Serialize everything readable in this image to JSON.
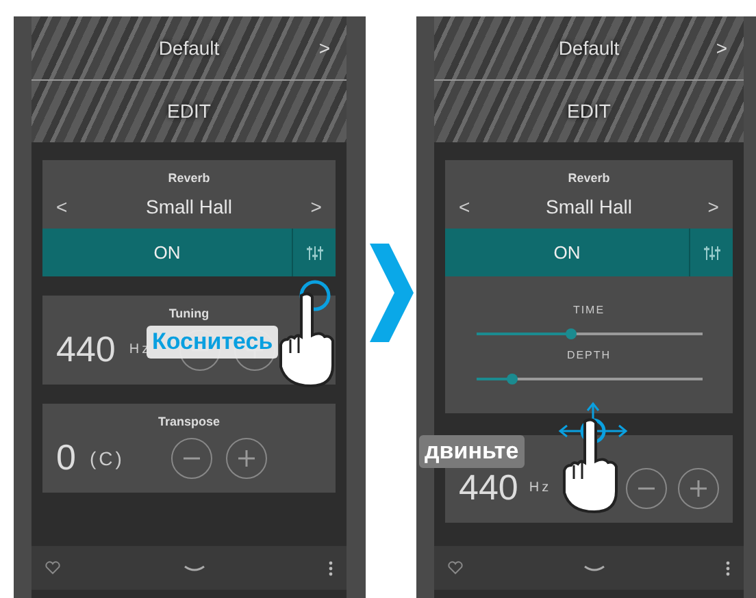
{
  "screens": [
    {
      "header": {
        "preset": "Default",
        "next": ">",
        "edit": "EDIT"
      },
      "reverb": {
        "title": "Reverb",
        "prev": "<",
        "value": "Small Hall",
        "next": ">",
        "status": "ON",
        "on": true
      },
      "cards": [
        {
          "title": "Tuning",
          "value": "440",
          "unit": "Hz"
        },
        {
          "title": "Transpose",
          "value": "0",
          "unit": "(C)"
        }
      ],
      "gesture": {
        "kind": "tap",
        "label": "Коснитесь"
      }
    },
    {
      "header": {
        "preset": "Default",
        "next": ">",
        "edit": "EDIT"
      },
      "reverb": {
        "title": "Reverb",
        "prev": "<",
        "value": "Small Hall",
        "next": ">",
        "status": "ON",
        "on": true
      },
      "sliders": [
        {
          "label": "TIME",
          "level": 0.42
        },
        {
          "label": "DEPTH",
          "level": 0.16
        }
      ],
      "cards": [
        {
          "value": "440",
          "unit": "Hz"
        }
      ],
      "gesture": {
        "kind": "drag",
        "label": "двиньте"
      }
    }
  ]
}
